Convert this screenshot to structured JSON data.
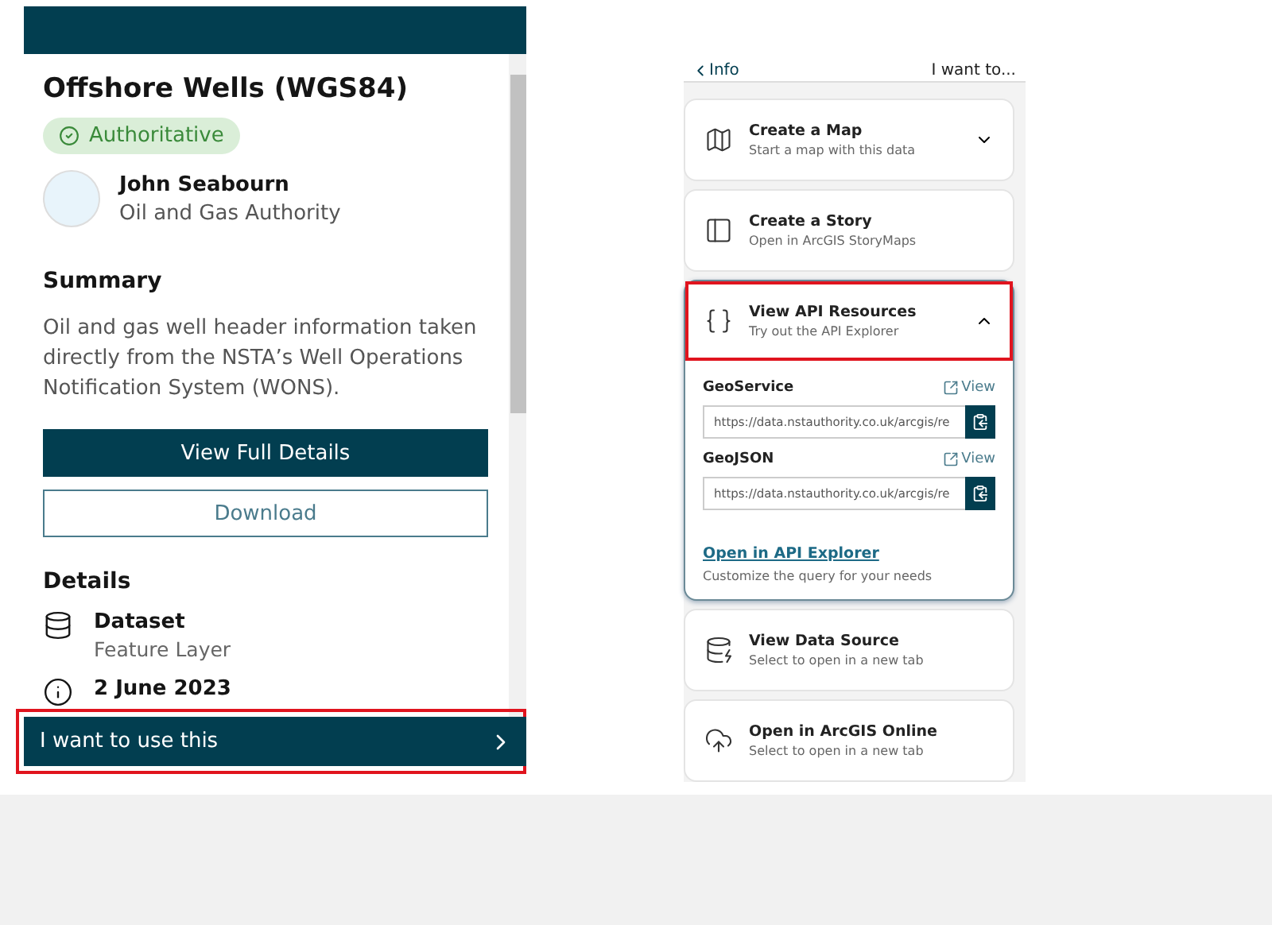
{
  "left_panel": {
    "title": "Offshore Wells (WGS84)",
    "badge": "Authoritative",
    "owner": {
      "name": "John Seabourn",
      "organization": "Oil and Gas Authority"
    },
    "summary": {
      "heading": "Summary",
      "text": "Oil and gas well header information taken directly from the NSTA’s Well Operations Notification System (WONS)."
    },
    "buttons": [
      {
        "label": "View Full Details",
        "kind": "primary"
      },
      {
        "label": "Download",
        "kind": "outline"
      }
    ],
    "details": {
      "heading": "Details",
      "items": [
        {
          "kind": "dataset",
          "title": "Dataset",
          "subtitle": "Feature Layer"
        },
        {
          "kind": "info",
          "title": "2 June 2023"
        }
      ]
    },
    "action_bar": {
      "label": "I want to use this",
      "highlighted": true
    }
  },
  "right_panel": {
    "back_link": "Info",
    "title": "I want to...",
    "cards": [
      {
        "kind": "map",
        "title": "Create a Map",
        "subtitle": "Start a map with this data",
        "expanded": false,
        "highlighted": false,
        "has_toggle": true
      },
      {
        "kind": "story",
        "title": "Create a Story",
        "subtitle": "Open in ArcGIS StoryMaps",
        "expanded": false,
        "highlighted": false,
        "has_toggle": false
      },
      {
        "kind": "api",
        "title": "View API Resources",
        "subtitle": "Try out the API Explorer",
        "expanded": true,
        "highlighted": true,
        "has_toggle": true,
        "resources": [
          {
            "label": "GeoService",
            "view": "View",
            "url": "https://data.nstauthority.co.uk/arcgis/re"
          },
          {
            "label": "GeoJSON",
            "view": "View",
            "url": "https://data.nstauthority.co.uk/arcgis/re"
          }
        ],
        "link": "Open in API Explorer",
        "link_caption": "Customize the query for your needs"
      },
      {
        "kind": "source",
        "title": "View Data Source",
        "subtitle": "Select to open in a new tab",
        "expanded": false,
        "highlighted": false,
        "has_toggle": false
      },
      {
        "kind": "online",
        "title": "Open in ArcGIS Online",
        "subtitle": "Select to open in a new tab",
        "expanded": false,
        "highlighted": false,
        "has_toggle": false
      }
    ]
  }
}
